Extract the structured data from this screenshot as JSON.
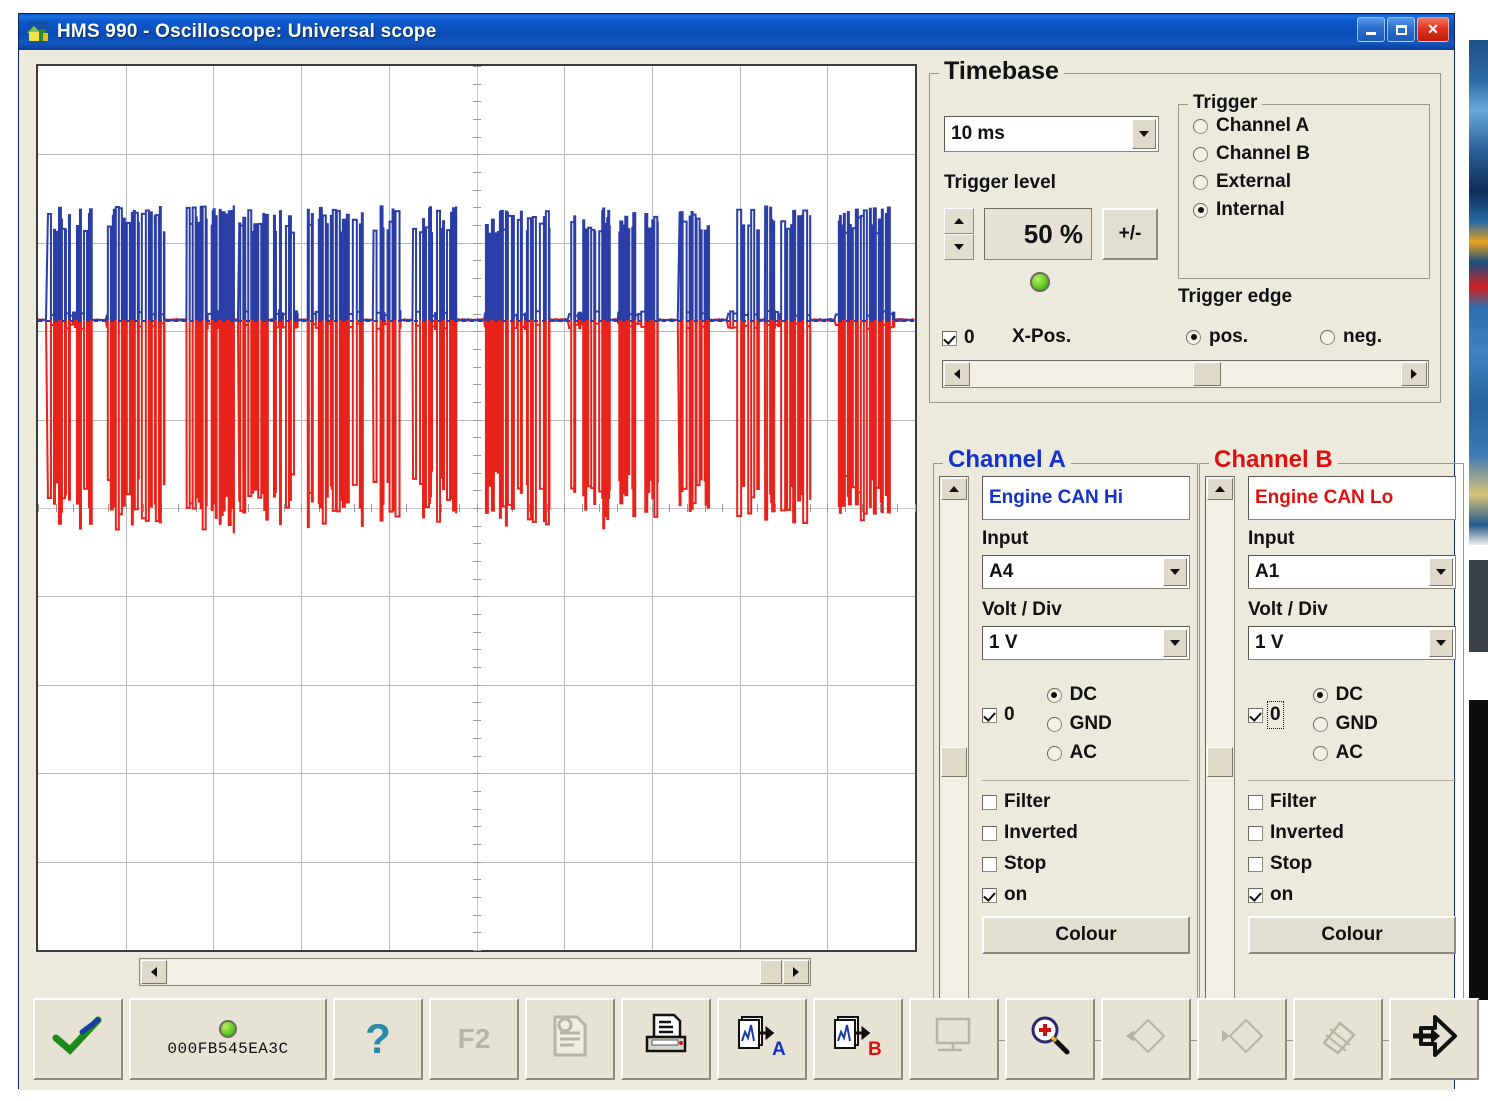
{
  "window": {
    "title": "HMS 990 - Oscilloscope: Universal scope",
    "icon": "app-house-icon",
    "buttons": {
      "minimize": "minimize-icon",
      "maximize": "maximize-icon",
      "close": "close-icon"
    }
  },
  "scope": {
    "grid": {
      "columns": 10,
      "rows": 10,
      "center_cross": true
    },
    "hscroll": {
      "left_arrow": "◄",
      "right_arrow": "►"
    },
    "traces": [
      {
        "name": "Channel A",
        "color": "#2b3ea8"
      },
      {
        "name": "Channel B",
        "color": "#e8231c"
      }
    ],
    "zero_line_color": "#2b3ea8"
  },
  "timebase": {
    "title": "Timebase",
    "timebase_value": "10 ms",
    "trigger_level_label": "Trigger level",
    "trigger_level_value": "50 %",
    "plus_minus_label": "+/-",
    "led": "status-led-green",
    "xpos": {
      "checked": true,
      "value": "0",
      "label": "X-Pos."
    },
    "xpos_scroll": {
      "left_arrow": "◄",
      "right_arrow": "►"
    }
  },
  "trigger": {
    "title": "Trigger",
    "options": [
      {
        "label": "Channel A",
        "selected": false
      },
      {
        "label": "Channel B",
        "selected": false
      },
      {
        "label": "External",
        "selected": false
      },
      {
        "label": "Internal",
        "selected": true
      }
    ],
    "edge_label": "Trigger edge",
    "edge_options": [
      {
        "label": "pos.",
        "selected": true
      },
      {
        "label": "neg.",
        "selected": false
      }
    ]
  },
  "channel_a": {
    "title": "Channel A",
    "color": "#1432c8",
    "name_value": "Engine CAN Hi",
    "input_label": "Input",
    "input_value": "A4",
    "voltdiv_label": "Volt / Div",
    "voltdiv_value": "1 V",
    "zero": {
      "checked": true,
      "value": "0",
      "focused": false
    },
    "coupling": [
      {
        "label": "DC",
        "selected": true
      },
      {
        "label": "GND",
        "selected": false
      },
      {
        "label": "AC",
        "selected": false
      }
    ],
    "checks": [
      {
        "label": "Filter",
        "checked": false
      },
      {
        "label": "Inverted",
        "checked": false
      },
      {
        "label": "Stop",
        "checked": false
      },
      {
        "label": "on",
        "checked": true
      }
    ],
    "colour_button": "Colour"
  },
  "channel_b": {
    "title": "Channel B",
    "color": "#e01010",
    "name_value": "Engine CAN Lo",
    "input_label": "Input",
    "input_value": "A1",
    "voltdiv_label": "Volt / Div",
    "voltdiv_value": "1 V",
    "zero": {
      "checked": true,
      "value": "0",
      "focused": true
    },
    "coupling": [
      {
        "label": "DC",
        "selected": true
      },
      {
        "label": "GND",
        "selected": false
      },
      {
        "label": "AC",
        "selected": false
      }
    ],
    "checks": [
      {
        "label": "Filter",
        "checked": false
      },
      {
        "label": "Inverted",
        "checked": false
      },
      {
        "label": "Stop",
        "checked": false
      },
      {
        "label": "on",
        "checked": true
      }
    ],
    "colour_button": "Colour"
  },
  "toolbar": {
    "items": [
      {
        "name": "ok-check-button",
        "icon": "green-check-icon",
        "label": "",
        "enabled": true
      },
      {
        "name": "device-status-button",
        "icon": "status-led-green",
        "label": "000FB545EA3C",
        "enabled": true
      },
      {
        "name": "help-button",
        "icon": "question-mark-icon",
        "label": "",
        "enabled": true
      },
      {
        "name": "f2-button",
        "icon": "f2-key-icon",
        "label": "F2",
        "enabled": false
      },
      {
        "name": "report-button",
        "icon": "document-chart-icon",
        "label": "",
        "enabled": false
      },
      {
        "name": "print-button",
        "icon": "printer-icon",
        "label": "",
        "enabled": true
      },
      {
        "name": "store-to-a-button",
        "icon": "store-waveform-a-icon",
        "label": "A",
        "enabled": true
      },
      {
        "name": "store-to-b-button",
        "icon": "store-waveform-b-icon",
        "label": "B",
        "enabled": true
      },
      {
        "name": "screen-button",
        "icon": "monitor-icon",
        "label": "",
        "enabled": false
      },
      {
        "name": "zoom-button",
        "icon": "magnifier-plus-icon",
        "label": "",
        "enabled": true
      },
      {
        "name": "prev-button",
        "icon": "prev-diamond-icon",
        "label": "",
        "enabled": false
      },
      {
        "name": "next-button",
        "icon": "next-diamond-icon",
        "label": "",
        "enabled": false
      },
      {
        "name": "erase-button",
        "icon": "eraser-icon",
        "label": "",
        "enabled": false
      },
      {
        "name": "exit-button",
        "icon": "exit-arrow-icon",
        "label": "",
        "enabled": true
      }
    ]
  }
}
